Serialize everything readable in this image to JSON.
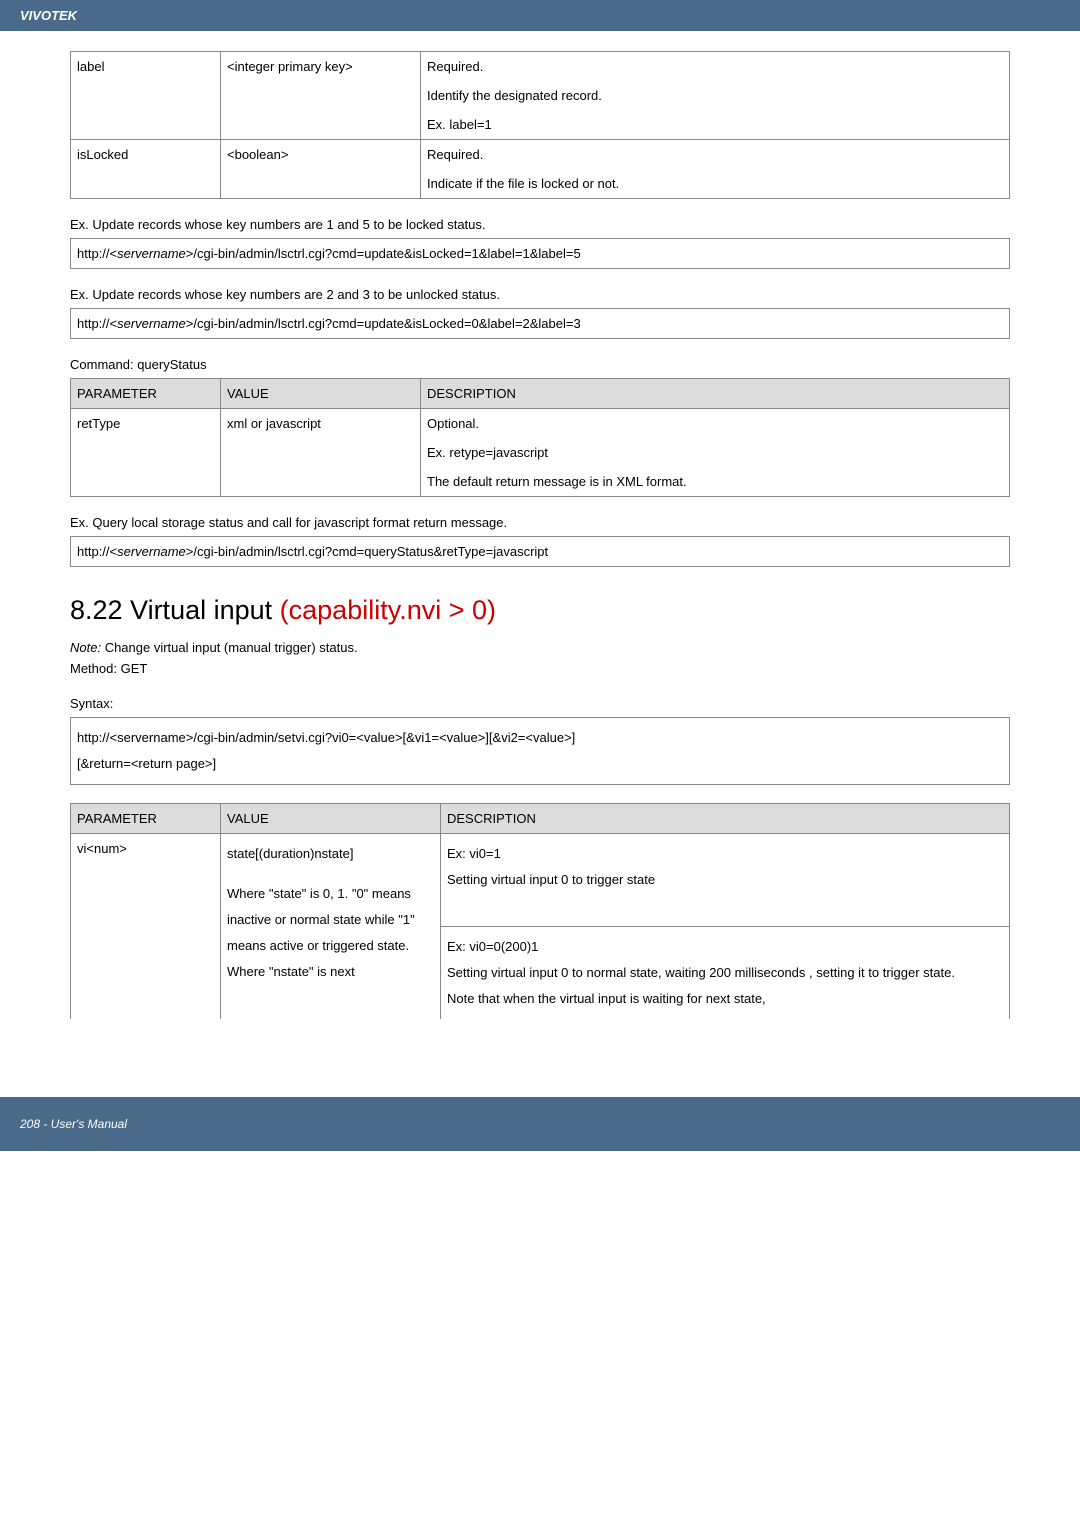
{
  "header": "VIVOTEK",
  "table1": {
    "r1": {
      "p": "label",
      "v": "<integer primary key>",
      "d1": "Required.",
      "d2": "Identify the designated record.",
      "d3": "Ex. label=1"
    },
    "r2": {
      "p": "isLocked",
      "v": "<boolean>",
      "d1": "Required.",
      "d2": "Indicate if the file is locked or not."
    }
  },
  "ex1": {
    "label": "Ex. Update records whose key numbers are 1 and 5 to be locked status.",
    "pre": "http://<",
    "server": "servername",
    "post": ">/cgi-bin/admin/lsctrl.cgi?cmd=update&isLocked=1&label=1&label=5"
  },
  "ex2": {
    "label": "Ex. Update records whose key numbers are 2 and 3 to be unlocked status.",
    "pre": "http://<",
    "server": "servername",
    "post": ">/cgi-bin/admin/lsctrl.cgi?cmd=update&isLocked=0&label=2&label=3"
  },
  "cmd": "Command: queryStatus",
  "table2": {
    "h": {
      "p": "PARAMETER",
      "v": "VALUE",
      "d": "DESCRIPTION"
    },
    "r1": {
      "p": "retType",
      "v": "xml or javascript",
      "d1": "Optional.",
      "d2": "Ex. retype=javascript",
      "d3": "The default return message is in XML format."
    }
  },
  "ex3": {
    "label": "Ex. Query local storage status and call for javascript format return message.",
    "pre": "http://<",
    "server": "servername",
    "post": ">/cgi-bin/admin/lsctrl.cgi?cmd=queryStatus&retType=javascript"
  },
  "section": {
    "title": "8.22 Virtual input ",
    "cap": "(capability.nvi > 0)"
  },
  "note": {
    "prefix": "Note:",
    "body": "  Change virtual input (manual trigger) status."
  },
  "method": "Method: GET",
  "syntax": "Syntax:",
  "syn": {
    "l1": "http://<servername>/cgi-bin/admin/setvi.cgi?vi0=<value>[&vi1=<value>][&vi2=<value>]",
    "l2": "[&return=<return page>]"
  },
  "table3": {
    "h": {
      "p": "PARAMETER",
      "v": "VALUE",
      "d": "DESCRIPTION"
    },
    "r1": {
      "p": "vi<num>",
      "v1": "state[(duration)nstate]",
      "v2": "Where \"state\" is 0, 1. \"0\" means inactive or normal state while \"1\" means active or triggered state. Where \"nstate\" is next",
      "d1a": "Ex: vi0=1",
      "d1b": "Setting virtual input 0 to trigger state",
      "d2a": "Ex: vi0=0(200)1",
      "d2b": "Setting virtual input 0 to normal state, waiting 200 milliseconds , setting it to trigger state.",
      "d2c": "Note that when the virtual input is waiting for next state,"
    }
  },
  "footer": "208 - User's Manual"
}
